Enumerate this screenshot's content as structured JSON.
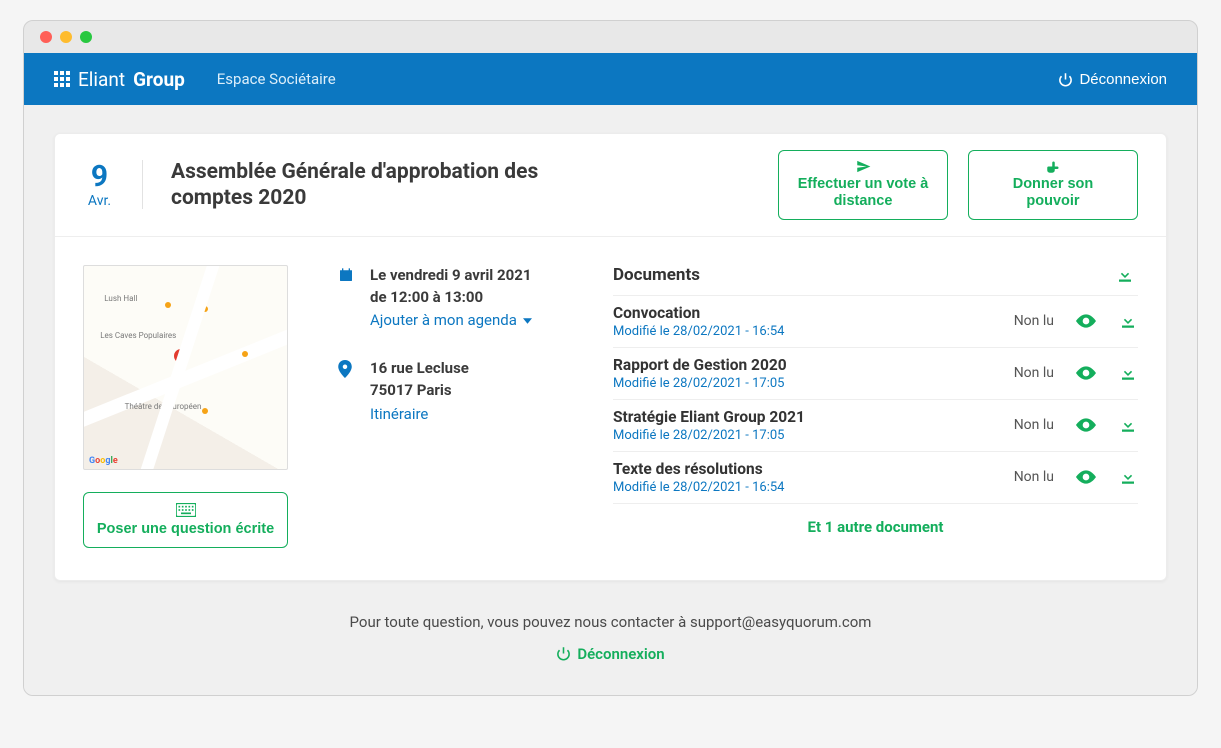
{
  "brand": {
    "text_a": "Eliant",
    "text_b": "Group"
  },
  "nav": {
    "espace": "Espace Sociétaire",
    "logout": "Déconnexion"
  },
  "event": {
    "day": "9",
    "month": "Avr.",
    "title": "Assemblée Générale d'approbation des comptes 2020",
    "vote_remote": "Effectuer un vote à distance",
    "proxy": "Donner son pouvoir",
    "datetime_line1": "Le vendredi 9 avril 2021",
    "datetime_line2": "de 12:00 à 13:00",
    "add_calendar": "Ajouter à mon agenda",
    "address_line1": "16 rue Lecluse",
    "address_line2": "75017 Paris",
    "directions": "Itinéraire",
    "ask_question": "Poser une question écrite"
  },
  "documents": {
    "title": "Documents",
    "status_unread": "Non lu",
    "more": "Et 1 autre document",
    "items": [
      {
        "name": "Convocation",
        "meta": "Modifié le 28/02/2021 - 16:54"
      },
      {
        "name": "Rapport de Gestion 2020",
        "meta": "Modifié le 28/02/2021 - 17:05"
      },
      {
        "name": "Stratégie Eliant Group 2021",
        "meta": "Modifié le 28/02/2021 - 17:05"
      },
      {
        "name": "Texte des résolutions",
        "meta": "Modifié le 28/02/2021 - 16:54"
      }
    ]
  },
  "footer": {
    "contact": "Pour toute question, vous pouvez nous contacter à support@easyquorum.com",
    "logout": "Déconnexion"
  },
  "colors": {
    "primary": "#0c77c1",
    "accent": "#14ae5c"
  }
}
